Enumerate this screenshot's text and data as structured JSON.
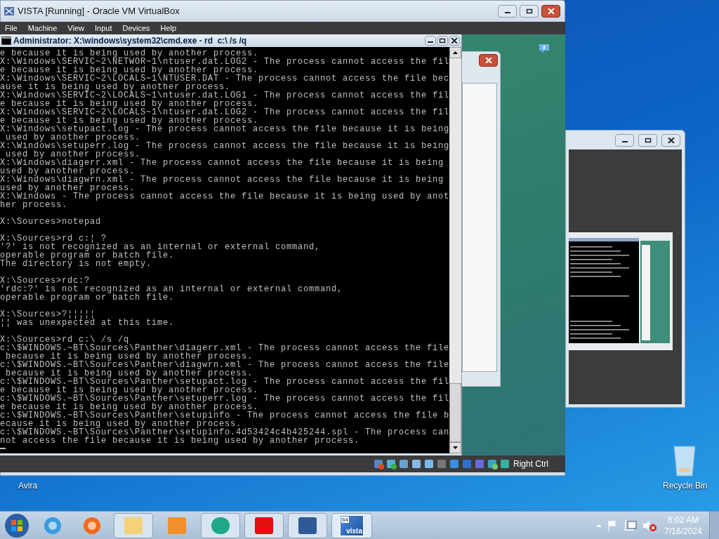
{
  "vbox": {
    "title": "VISTA [Running] - Oracle VM VirtualBox",
    "menu": [
      "File",
      "Machine",
      "View",
      "Input",
      "Devices",
      "Help"
    ],
    "host_key": "Right Ctrl"
  },
  "cmd": {
    "title": "Administrator: X:\\windows\\system32\\cmd.exe - rd  c:\\ /s /q",
    "blocks": [
      [
        "e because it is being used by another process.",
        "X:\\Windows\\SERVIC~2\\NETWOR~1\\ntuser.dat.LOG2 - The process cannot access the fil",
        "e because it is being used by another process.",
        "X:\\Windows\\SERVIC~2\\LOCALS~1\\NTUSER.DAT - The process cannot access the file bec",
        "ause it is being used by another process.",
        "X:\\Windows\\SERVIC~2\\LOCALS~1\\ntuser.dat.LOG1 - The process cannot access the fil",
        "e because it is being used by another process.",
        "X:\\Windows\\SERVIC~2\\LOCALS~1\\ntuser.dat.LOG2 - The process cannot access the fil",
        "e because it is being used by another process.",
        "X:\\Windows\\setupact.log - The process cannot access the file because it is being",
        " used by another process.",
        "X:\\Windows\\setuperr.log - The process cannot access the file because it is being",
        " used by another process.",
        "X:\\Windows\\diagerr.xml - The process cannot access the file because it is being",
        "used by another process.",
        "X:\\Windows\\diagwrn.xml - The process cannot access the file because it is being",
        "used by another process.",
        "X:\\Windows - The process cannot access the file because it is being used by anot",
        "her process."
      ],
      [
        "X:\\Sources>notepad"
      ],
      [
        "X:\\Sources>rd c:¦ ?",
        "'?' is not recognized as an internal or external command,",
        "operable program or batch file.",
        "The directory is not empty."
      ],
      [
        "X:\\Sources>rdc:?",
        "'rdc:?' is not recognized as an internal or external command,",
        "operable program or batch file."
      ],
      [
        "X:\\Sources>?¦¦¦¦¦",
        "¦¦ was unexpected at this time."
      ],
      [
        "X:\\Sources>rd c:\\ /s /q",
        "c:\\$WINDOWS.~BT\\Sources\\Panther\\diagerr.xml - The process cannot access the file",
        " because it is being used by another process.",
        "c:\\$WINDOWS.~BT\\Sources\\Panther\\diagwrn.xml - The process cannot access the file",
        " because it is being used by another process.",
        "c:\\$WINDOWS.~BT\\Sources\\Panther\\setupact.log - The process cannot access the fil",
        "e because it is being used by another process.",
        "c:\\$WINDOWS.~BT\\Sources\\Panther\\setuperr.log - The process cannot access the fil",
        "e because it is being used by another process.",
        "c:\\$WINDOWS.~BT\\Sources\\Panther\\setupinfo - The process cannot access the file b",
        "ecause it is being used by another process.",
        "c:\\$WINDOWS.~BT\\Sources\\Panther\\setupinfo.4d53424c4b425244.spl - The process can",
        "not access the file because it is being used by another process."
      ]
    ]
  },
  "desktop": {
    "avira_label": "Avira",
    "recycle_bin_label": "Recycle Bin"
  },
  "taskbar": {
    "vista_badge": "64",
    "vista_word": "vista"
  },
  "clock": {
    "time": "6:02 AM",
    "date": "7/16/2024"
  }
}
